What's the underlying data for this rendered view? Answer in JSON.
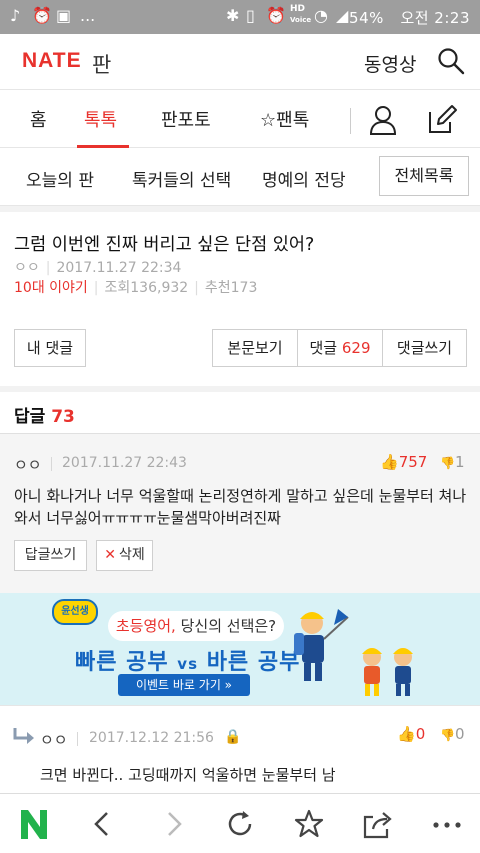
{
  "status_bar": {
    "battery": "54%",
    "time": "오전 2:23",
    "hd_label": "HD",
    "voice_label": "Voice",
    "more": "..."
  },
  "header": {
    "logo": "NATE",
    "section": "판",
    "video_link": "동영상"
  },
  "nav": {
    "tabs": [
      "홈",
      "톡톡",
      "판포토",
      "팬톡"
    ],
    "active_tab": "톡톡"
  },
  "subnav": {
    "items": [
      "오늘의 판",
      "톡커들의 선택",
      "명예의 전당"
    ],
    "all_list": "전체목록"
  },
  "article": {
    "title": "그럼 이번엔 진짜 버리고 싶은 단점 있어?",
    "author": "ㅇㅇ",
    "date": "2017.11.27 22:34",
    "category": "10대 이야기",
    "views": "조회136,932",
    "recommends": "추천173"
  },
  "actions": {
    "my_comment": "내 댓글",
    "view_body": "본문보기",
    "comments_label": "댓글",
    "comments_count": "629",
    "write_comment": "댓글쓰기"
  },
  "replies": {
    "label": "답글",
    "count": "73"
  },
  "comments": [
    {
      "author": "ㅇㅇ",
      "date": "2017.11.27 22:43",
      "likes": "757",
      "dislikes": "1",
      "text": "아니 화나거나 너무 억울할때 논리정연하게 말하고 싶은데 눈물부터 쳐나와서 너무싫어ㅠㅠㅠㅠ눈물샘막아버려진짜",
      "reply_btn": "답글쓰기",
      "delete_btn": "삭제"
    },
    {
      "author": "ㅇㅇ",
      "date": "2017.12.12 21:56",
      "likes": "0",
      "dislikes": "0",
      "text": "크면 바뀐다.. 고딩때까지 억울하면 눈물부터 남"
    }
  ],
  "ad": {
    "logo": "윤선생",
    "headline_accent": "초등영어,",
    "headline_rest": " 당신의 선택은?",
    "main_left": "빠른 공부",
    "vs": "vs",
    "main_right": "바른 공부",
    "cta": "이벤트 바로 가기 »"
  },
  "colors": {
    "accent": "#e8322d",
    "status_bar": "#9e9e9e",
    "comment_bg": "#f5f5f5",
    "ad_bg": "#d9f2f6",
    "ad_blue": "#1565c0"
  }
}
